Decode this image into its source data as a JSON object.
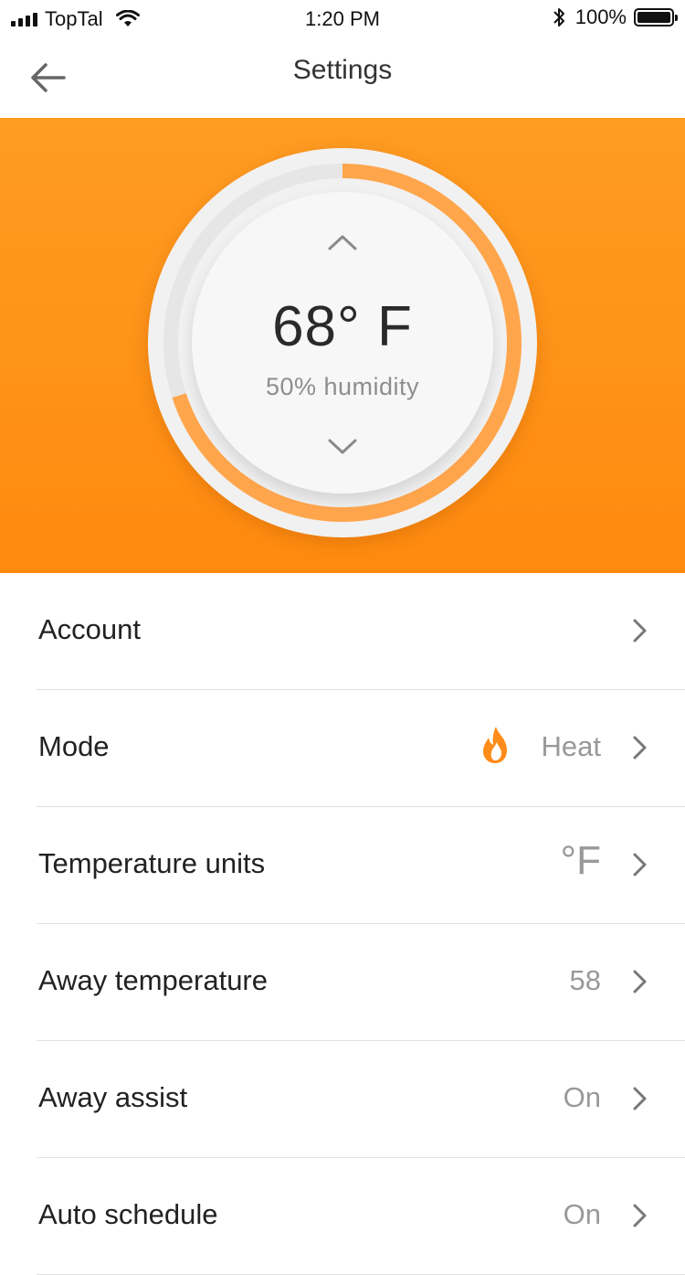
{
  "status_bar": {
    "carrier": "TopTal",
    "time": "1:20 PM",
    "battery": "100%",
    "battery_level": 1.0,
    "icons": [
      "signal-icon",
      "wifi-icon",
      "bluetooth-icon",
      "battery-icon"
    ]
  },
  "nav": {
    "title": "Settings",
    "back_icon": "arrow-left-icon"
  },
  "thermostat": {
    "temperature": "68° F",
    "humidity": "50% humidity",
    "progress_fraction": 0.7,
    "accent_color": "#ff9424",
    "track_color": "#e6e6e6",
    "progress_color": "#ffa64d"
  },
  "settings": {
    "items": [
      {
        "label": "Account",
        "value": ""
      },
      {
        "label": "Mode",
        "value": "Heat",
        "icon": "flame-icon"
      },
      {
        "label": "Temperature units",
        "value": "°F"
      },
      {
        "label": "Away temperature",
        "value": "58"
      },
      {
        "label": "Away assist",
        "value": "On"
      },
      {
        "label": "Auto schedule",
        "value": "On"
      }
    ]
  },
  "colors": {
    "hero_top": "#ff9c22",
    "hero_bottom": "#ff8a0f",
    "flame": "#ff8c1a"
  }
}
